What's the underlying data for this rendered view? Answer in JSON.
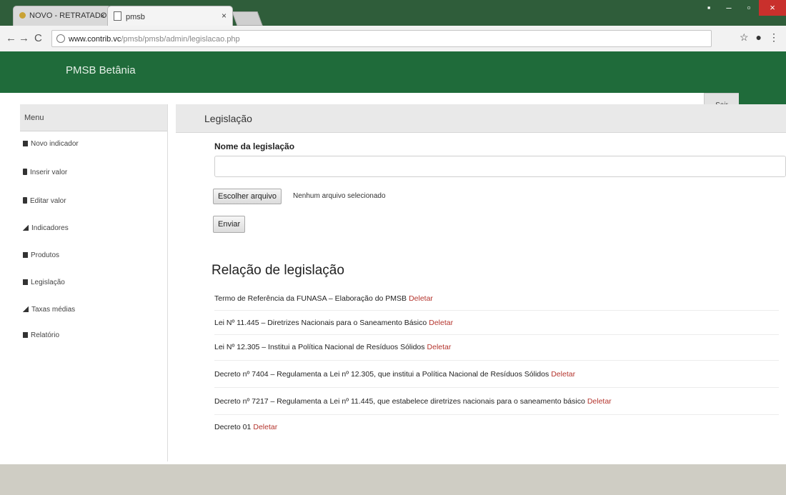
{
  "browser": {
    "tabs": [
      {
        "label": "NOVO - RETRATADOR",
        "active": false
      },
      {
        "label": "pmsb",
        "active": true
      }
    ],
    "url_host": "www.contrib.vc",
    "url_path": "/pmsb/pmsb/admin/legislacao.php",
    "colors": {
      "tabbar": "#2f5d3a",
      "close": "#c9302c"
    }
  },
  "app": {
    "brand": "PMSB Betânia",
    "logout_label": "Sair",
    "header_color": "#1f6b3a"
  },
  "sidebar": {
    "header": "Menu",
    "items": [
      {
        "label": "Novo indicador",
        "icon": "list-icon"
      },
      {
        "label": "Inserir valor",
        "icon": "pencil-icon"
      },
      {
        "label": "Editar valor",
        "icon": "pencil-icon"
      },
      {
        "label": "Indicadores",
        "icon": "chart-icon"
      },
      {
        "label": "Produtos",
        "icon": "list-icon"
      },
      {
        "label": "Legislação",
        "icon": "list-icon"
      },
      {
        "label": "Taxas médias",
        "icon": "chart-icon"
      },
      {
        "label": "Relatório",
        "icon": "list-icon"
      }
    ]
  },
  "main": {
    "title": "Legislação",
    "form": {
      "name_label": "Nome da legislação",
      "name_value": "",
      "file_button": "Escolher arquivo",
      "file_status": "Nenhum arquivo selecionado",
      "submit": "Enviar"
    },
    "list_title": "Relação de legislação",
    "delete_label": "Deletar",
    "delete_color": "#b4342d",
    "items": [
      "Termo de Referência da FUNASA – Elaboração do PMSB",
      "Lei Nº 11.445 – Diretrizes Nacionais para o Saneamento Básico",
      "Lei Nº 12.305 – Institui a Política Nacional de Resíduos Sólidos",
      "Decreto nº 7404 – Regulamenta a Lei nº 12.305, que institui a Política Nacional de Resíduos Sólidos",
      "Decreto nº 7217 – Regulamenta a Lei nº 11.445, que estabelece diretrizes nacionais para o saneamento básico",
      "Decreto 01"
    ]
  }
}
